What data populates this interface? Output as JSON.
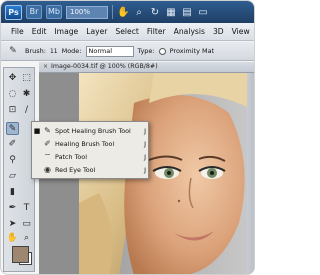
{
  "appbar": {
    "logo": "Ps",
    "icons": [
      "Br",
      "Mb"
    ],
    "zoom": "100%",
    "tools": [
      "hand-icon",
      "zoom-icon",
      "rotate-icon",
      "grid-icon",
      "arrange-icon",
      "screen-mode-icon"
    ]
  },
  "menubar": {
    "items": [
      "File",
      "Edit",
      "Image",
      "Layer",
      "Select",
      "Filter",
      "Analysis",
      "3D",
      "View"
    ]
  },
  "options": {
    "brush_label": "Brush:",
    "brush_size": "11",
    "mode_label": "Mode:",
    "mode_value": "Normal",
    "type_label": "Type:",
    "type_value": "Proximity Mat"
  },
  "document": {
    "title": "Image-0034.tif @ 100% (RGB/8#)",
    "close_glyph": "×"
  },
  "colors": {
    "foreground": "#9e8770",
    "background": "#ffffff",
    "accent": "#2f5d8f"
  },
  "flyout": {
    "items": [
      {
        "checked": "■",
        "label": "Spot Healing Brush Tool",
        "key": "J"
      },
      {
        "checked": "",
        "label": "Healing Brush Tool",
        "key": "J"
      },
      {
        "checked": "",
        "label": "Patch Tool",
        "key": "J"
      },
      {
        "checked": "",
        "label": "Red Eye Tool",
        "key": "J"
      }
    ]
  }
}
